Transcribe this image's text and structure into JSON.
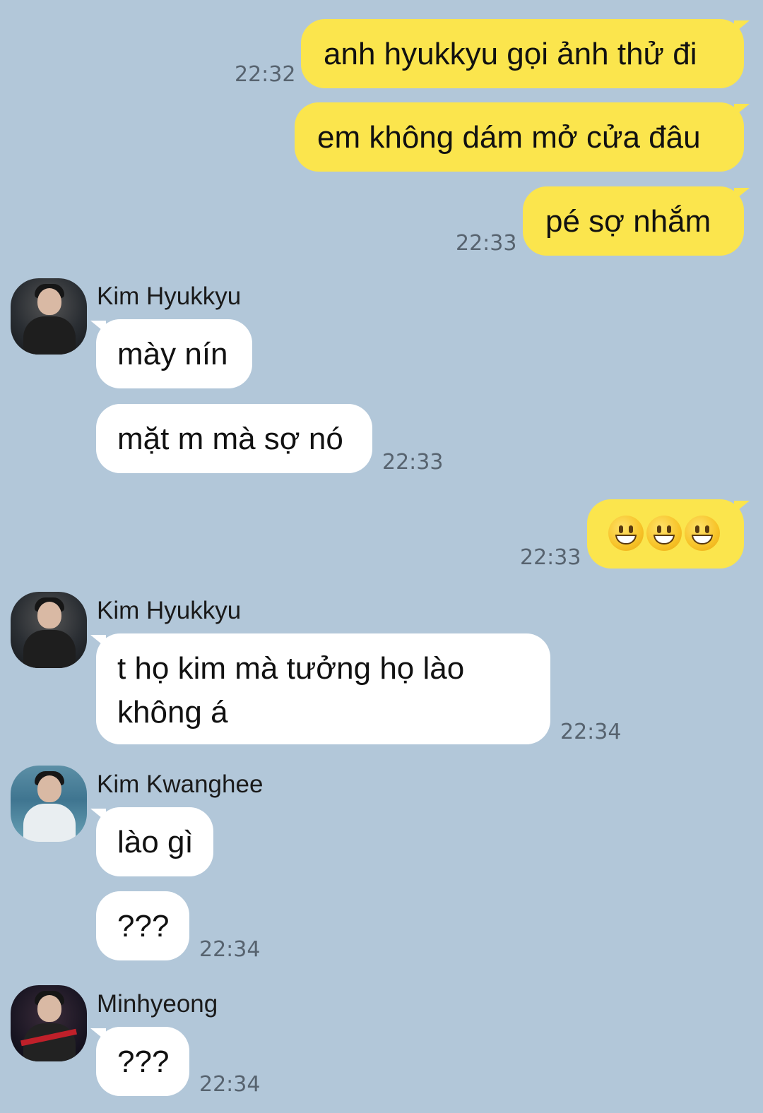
{
  "messages": [
    {
      "side": "out",
      "text": "anh hyukkyu gọi ảnh thử đi",
      "time": "22:32"
    },
    {
      "side": "out",
      "text": "em không dám mở cửa đâu"
    },
    {
      "side": "out",
      "text": "pé sợ nhắm",
      "time": "22:33"
    },
    {
      "side": "in",
      "sender": "Kim Hyukkyu",
      "text": "mày nín"
    },
    {
      "side": "in",
      "text": "mặt m mà sợ nó",
      "time": "22:33"
    },
    {
      "side": "out",
      "emoji": [
        "grinning-face",
        "grinning-face",
        "grinning-face"
      ],
      "time": "22:33"
    },
    {
      "side": "in",
      "sender": "Kim Hyukkyu",
      "lines": [
        "t họ kim mà tưởng họ lào",
        "không á"
      ],
      "time": "22:34"
    },
    {
      "side": "in",
      "sender": "Kim Kwanghee",
      "text": "lào gì"
    },
    {
      "side": "in",
      "text": "???",
      "time": "22:34"
    },
    {
      "side": "in",
      "sender": "Minhyeong",
      "text": "???",
      "time": "22:34"
    }
  ],
  "colors": {
    "background": "#b2c7d9",
    "outgoing_bubble": "#fbe54d",
    "incoming_bubble": "#ffffff",
    "timestamp": "#57636f"
  }
}
